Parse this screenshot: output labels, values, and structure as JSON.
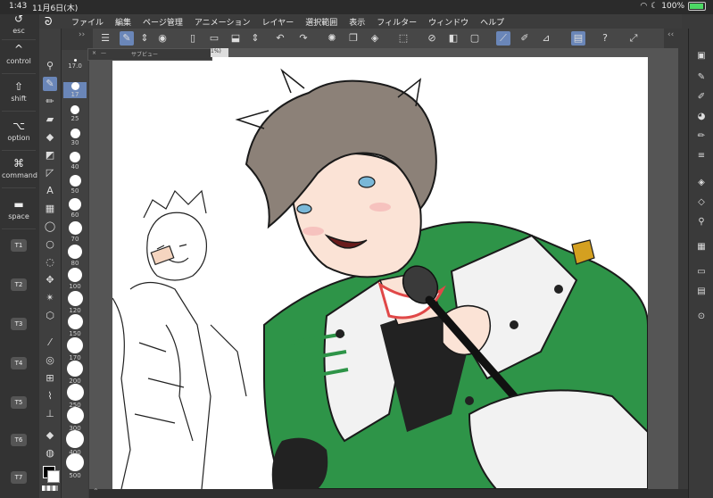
{
  "status": {
    "time": "1:43",
    "date": "11月6日(木)",
    "battery": "100%"
  },
  "menu": [
    "ファイル",
    "編集",
    "ページ管理",
    "アニメーション",
    "レイヤー",
    "選択範囲",
    "表示",
    "フィルター",
    "ウィンドウ",
    "ヘルプ"
  ],
  "keys": {
    "esc": "esc",
    "control": "control",
    "shift": "shift",
    "option": "option",
    "command": "command",
    "space": "space",
    "t": [
      "T1",
      "T2",
      "T3",
      "T4",
      "T5",
      "T6",
      "T7"
    ]
  },
  "brush_sizes": [
    "17.0",
    "17",
    "25",
    "30",
    "40",
    "50",
    "60",
    "70",
    "80",
    "100",
    "120",
    "150",
    "170",
    "200",
    "250",
    "300",
    "400",
    "500"
  ],
  "subview": {
    "title": "サブビュー",
    "close": "×",
    "minimize": "—"
  },
  "canvas_tab": {
    "label": "1%)"
  },
  "colors": {
    "main": "#000000",
    "sub": "#ffffff",
    "accent": "#6a86b8"
  }
}
